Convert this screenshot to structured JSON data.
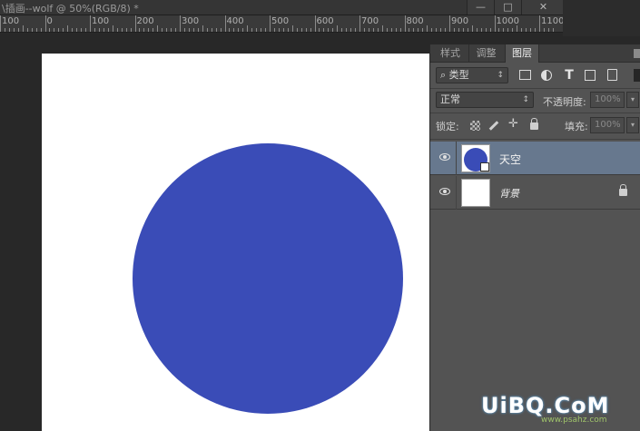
{
  "document": {
    "title": "\\插画--wolf @ 50%(RGB/8) *",
    "window_buttons": {
      "minimize": "—",
      "maximize": "□",
      "close": "✕"
    }
  },
  "ruler": {
    "labels": [
      "100",
      "0",
      "100",
      "200",
      "300",
      "400",
      "500",
      "600",
      "700",
      "800",
      "900",
      "1000",
      "1100"
    ]
  },
  "panel": {
    "tabs": [
      "样式",
      "调整",
      "图层"
    ],
    "active_tab": "图层",
    "filter": {
      "label": "⌕ 类型",
      "arrow": "↕"
    },
    "blend_mode": {
      "value": "正常",
      "arrow": "↕"
    },
    "opacity": {
      "label": "不透明度:",
      "value": "100%",
      "arrow": "▾"
    },
    "lock": {
      "label": "锁定:",
      "move_glyph": "✛"
    },
    "fill": {
      "label": "填充:",
      "value": "100%",
      "arrow": "▾"
    },
    "text_filter_glyph": "T"
  },
  "layers": [
    {
      "name": "天空",
      "selected": true,
      "visible": true,
      "locked": false
    },
    {
      "name": "背景",
      "selected": false,
      "visible": true,
      "locked": true
    }
  ],
  "colors": {
    "circle_fill": "#3a4cb7",
    "selected_layer": "#67788e",
    "canvas": "#ffffff"
  },
  "watermark": {
    "main": "UiBQ.CoM",
    "sub": "www.psahz.com"
  }
}
